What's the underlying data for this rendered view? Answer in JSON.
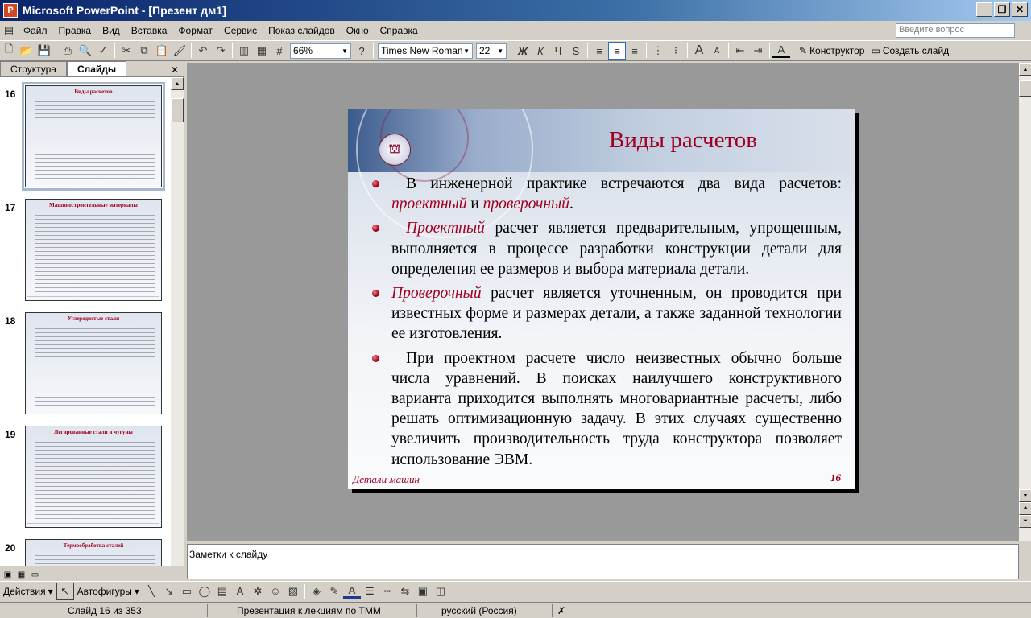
{
  "window": {
    "title": "Microsoft PowerPoint - [Презент дм1]"
  },
  "menu": {
    "items": [
      "Файл",
      "Правка",
      "Вид",
      "Вставка",
      "Формат",
      "Сервис",
      "Показ слайдов",
      "Окно",
      "Справка"
    ],
    "ask_placeholder": "Введите вопрос"
  },
  "toolbar": {
    "zoom": "66%",
    "font": "Times New Roman",
    "size": "22",
    "designer": "Конструктор",
    "new_slide": "Создать слайд"
  },
  "pane": {
    "tab_outline": "Структура",
    "tab_slides": "Слайды"
  },
  "thumbnails": [
    {
      "num": "16",
      "title": "Виды расчетов"
    },
    {
      "num": "17",
      "title": "Машиностроительные материалы"
    },
    {
      "num": "18",
      "title": "Углеродистые стали"
    },
    {
      "num": "19",
      "title": "Легированные стали и чугуны"
    },
    {
      "num": "20",
      "title": "Термообработка сталей"
    }
  ],
  "slide": {
    "title": "Виды расчетов",
    "b1": {
      "text": "В инженерной практике встречаются два вида расчетов:",
      "em1": "проектный",
      "and": "и",
      "em2": "проверочный",
      "end": "."
    },
    "b2": {
      "em": "Проектный",
      "text": "расчет является предварительным, упрощенным, выполняется в процессе разработки конструкции детали для определения ее размеров и выбора материала детали."
    },
    "b3": {
      "em": "Проверочный",
      "text": "расчет является уточненным, он проводится при известных форме и размерах детали, а также заданной технологии ее изготовления."
    },
    "b4": {
      "text": "При проектном расчете число неизвестных обычно больше числа уравнений. В поисках наилучшего конструктивного варианта приходится выполнять многовариантные расчеты, либо решать оптимизационную задачу. В этих случаях существенно увеличить производительность труда конструктора позволяет использование ЭВМ."
    },
    "footer": "Детали машин",
    "number": "16"
  },
  "notes": {
    "placeholder": "Заметки к слайду"
  },
  "drawing": {
    "actions": "Действия",
    "autoshapes": "Автофигуры"
  },
  "status": {
    "slide": "Слайд 16 из 353",
    "template": "Презентация к лекциям по ТММ",
    "language": "русский (Россия)"
  }
}
